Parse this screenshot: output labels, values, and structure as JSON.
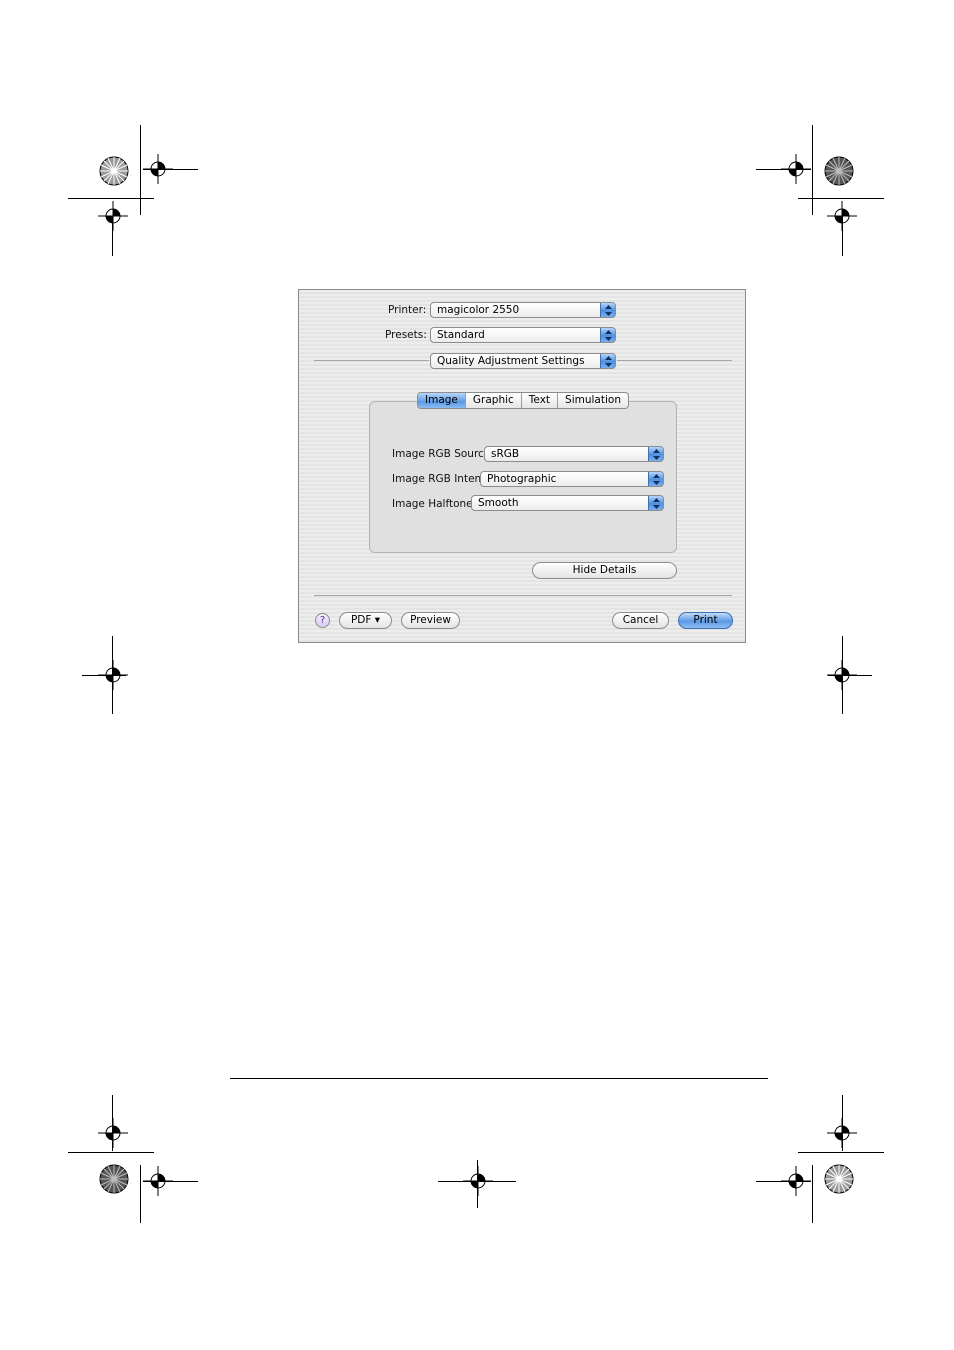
{
  "dialog": {
    "printer": {
      "label": "Printer:",
      "value": "magicolor 2550"
    },
    "presets": {
      "label": "Presets:",
      "value": "Standard"
    },
    "panel_menu": {
      "value": "Quality Adjustment Settings"
    },
    "tabs": [
      {
        "label": "Image",
        "active": true
      },
      {
        "label": "Graphic",
        "active": false
      },
      {
        "label": "Text",
        "active": false
      },
      {
        "label": "Simulation",
        "active": false
      }
    ],
    "image_rgb_source": {
      "label": "Image RGB Source:",
      "value": "sRGB"
    },
    "image_rgb_intent": {
      "label": "Image RGB Intent:",
      "value": "Photographic"
    },
    "image_halftone": {
      "label": "Image Halftone:",
      "value": "Smooth"
    },
    "hide_details_label": "Hide Details",
    "help_label": "?",
    "pdf_label": "PDF ▾",
    "preview_label": "Preview",
    "cancel_label": "Cancel",
    "print_label": "Print"
  },
  "icons": {
    "popup_arrows": "up-down-arrows-icon",
    "help": "help-icon",
    "registration": "registration-mark-icon",
    "color_star": "star-target-icon"
  },
  "colors": {
    "accent_blue": "#5d9ae4",
    "help_purple": "#5a2f9e"
  }
}
